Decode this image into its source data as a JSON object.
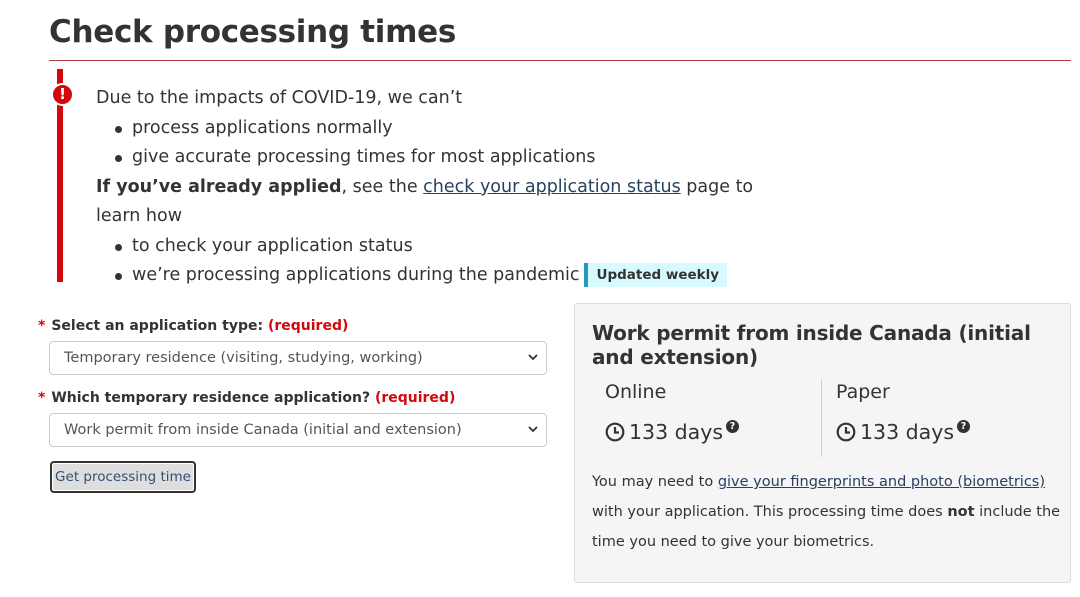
{
  "page": {
    "title": "Check processing times"
  },
  "alert": {
    "intro": "Due to the impacts of COVID-19, we can’t",
    "reasons": [
      "process applications normally",
      "give accurate processing times for most applications"
    ],
    "applied_bold": "If you’ve already applied",
    "applied_mid": ", see the ",
    "applied_link": "check your application status",
    "applied_end": " page to learn how",
    "steps": [
      "to check your application status",
      "we’re processing applications during the pandemic"
    ],
    "badge": "Updated weekly"
  },
  "form": {
    "app_type_label": "Select an application type:",
    "app_type_required": "(required)",
    "app_type_value": "Temporary residence (visiting, studying, working)",
    "temp_label": "Which temporary residence application?",
    "temp_required": "(required)",
    "temp_value": "Work permit from inside Canada (initial and extension)",
    "star": "*",
    "button": "Get processing time"
  },
  "result": {
    "title": "Work permit from inside Canada (initial and extension)",
    "online_label": "Online",
    "online_days": "133 days",
    "paper_label": "Paper",
    "paper_days": "133 days",
    "note_start": "You may need to ",
    "note_link": "give your fingerprints and photo (biometrics)",
    "note_mid": " with your application. This processing time does ",
    "note_bold": "not",
    "note_end": " include the time you need to give your biometrics."
  },
  "colors": {
    "alert": "#d3080c",
    "badge_bg": "#d7faff",
    "badge_border": "#269abc",
    "link": "#284162"
  }
}
